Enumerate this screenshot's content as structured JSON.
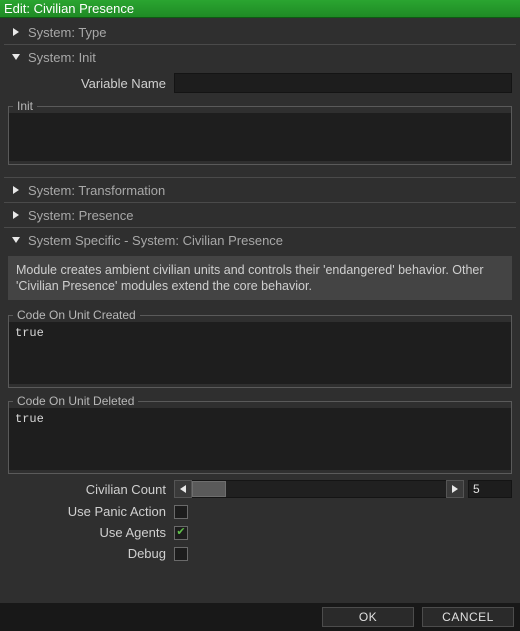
{
  "title": "Edit: Civilian Presence",
  "categories": {
    "type": {
      "label": "System: Type",
      "expanded": false
    },
    "init": {
      "label": "System: Init",
      "expanded": true
    },
    "transform": {
      "label": "System: Transformation",
      "expanded": false
    },
    "presence": {
      "label": "System: Presence",
      "expanded": false
    },
    "specific": {
      "label": "System Specific - System: Civilian Presence",
      "expanded": true
    }
  },
  "init": {
    "varname_label": "Variable Name",
    "varname_value": "",
    "init_legend": "Init",
    "init_code": ""
  },
  "specific": {
    "description": "Module creates ambient civilian units and controls their 'endangered' behavior. Other 'Civilian Presence' modules extend the core behavior.",
    "code_created_legend": "Code On Unit Created",
    "code_created_value": "true",
    "code_deleted_legend": "Code On Unit Deleted",
    "code_deleted_value": "true",
    "civ_count_label": "Civilian Count",
    "civ_count_value": "5",
    "use_panic_label": "Use Panic Action",
    "use_panic_checked": false,
    "use_agents_label": "Use Agents",
    "use_agents_checked": true,
    "debug_label": "Debug",
    "debug_checked": false
  },
  "footer": {
    "ok": "OK",
    "cancel": "CANCEL"
  }
}
